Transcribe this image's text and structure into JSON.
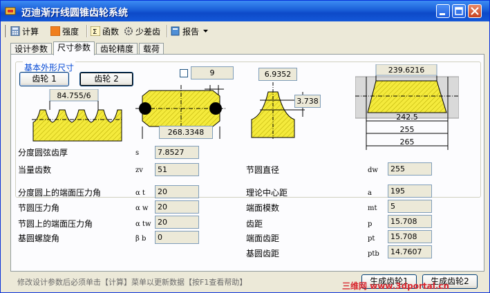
{
  "window": {
    "title": "迈迪渐开线圆锥齿轮系统"
  },
  "toolbar": {
    "calc": "计算",
    "strength": "强度",
    "function": "函数",
    "few_teeth": "少差齿",
    "report": "报告"
  },
  "tabs": [
    "设计参数",
    "尺寸参数",
    "齿轮精度",
    "载荷"
  ],
  "group_label": "基本外形尺寸",
  "buttons": {
    "gear1": "齿轮 1",
    "gear2": "齿轮 2",
    "generate1": "生成齿轮1",
    "generate2": "生成齿轮2"
  },
  "figures": {
    "tooth_pitch": "84.755/6",
    "box_top": "9",
    "bore_width": "268.3348",
    "tooth_height": "6.9352",
    "tooth_depth": "3.738",
    "cone_top": "239.6216",
    "cone_d1": "242.5",
    "cone_d2": "255",
    "cone_d3": "265"
  },
  "left_fields": [
    {
      "label": "分度圆弦齿厚",
      "symbol": "s",
      "value": "7.8527"
    },
    {
      "label": "当量齿数",
      "symbol": "zv",
      "value": "51"
    },
    {
      "label": "分度圆上的端面压力角",
      "symbol": "α t",
      "value": "20"
    },
    {
      "label": "节圆压力角",
      "symbol": "α w",
      "value": "20"
    },
    {
      "label": "节圆上的端面压力角",
      "symbol": "α tw",
      "value": "20"
    },
    {
      "label": "基圆螺旋角",
      "symbol": "β b",
      "value": "0"
    }
  ],
  "right_fields": [
    {
      "label": "节圆直径",
      "symbol": "dw",
      "value": "255"
    },
    {
      "label": "理论中心距",
      "symbol": "a",
      "value": "195"
    },
    {
      "label": "端面模数",
      "symbol": "mt",
      "value": "5"
    },
    {
      "label": "齿距",
      "symbol": "p",
      "value": "15.708"
    },
    {
      "label": "端面齿距",
      "symbol": "pt",
      "value": "15.708"
    },
    {
      "label": "基圆齿距",
      "symbol": "ptb",
      "value": "14.7607"
    }
  ],
  "status_text": "修改设计参数后必须单击【计算】菜单以更新数据【按F1查看帮助】",
  "watermark": "三维网 www.3dportal.cn"
}
